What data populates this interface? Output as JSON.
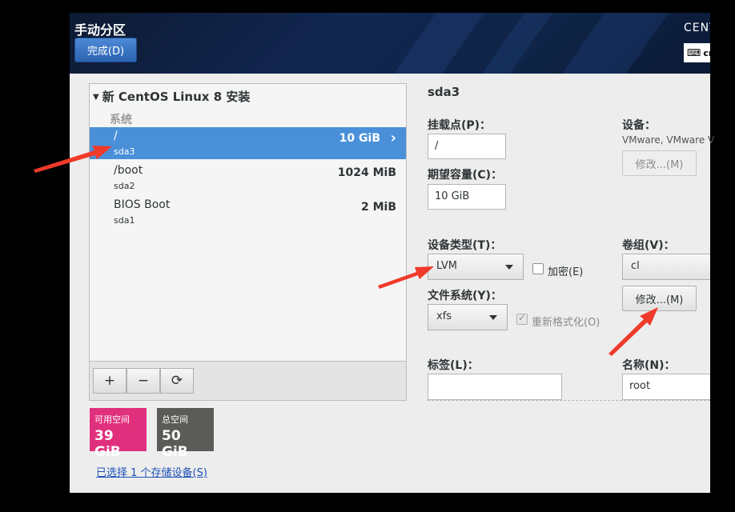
{
  "header": {
    "title": "手动分区",
    "done_label": "完成(D)",
    "product": "CENT",
    "keyboard": "cn"
  },
  "tree": {
    "install_title": "新 CentOS Linux 8 安装",
    "group_label": "系统",
    "partitions": [
      {
        "mount": "/",
        "device": "sda3",
        "size": "10 GiB",
        "selected": true
      },
      {
        "mount": "/boot",
        "device": "sda2",
        "size": "1024 MiB",
        "selected": false
      },
      {
        "mount": "BIOS Boot",
        "device": "sda1",
        "size": "2 MiB",
        "selected": false
      }
    ],
    "tools": {
      "add": "+",
      "remove": "−",
      "refresh": "⟳"
    }
  },
  "space": {
    "available_label": "可用空间",
    "available_value": "39 GiB",
    "total_label": "总空间",
    "total_value": "50 GiB"
  },
  "storage_link": "已选择 1 个存储设备(S)",
  "detail": {
    "title": "sda3",
    "mount_label": "挂载点(P)：",
    "mount_value": "/",
    "capacity_label": "期望容量(C)：",
    "capacity_value": "10 GiB",
    "device_label": "设备：",
    "device_value": "VMware, VMware V",
    "device_modify": "修改...(M)",
    "device_type_label": "设备类型(T)：",
    "device_type_value": "LVM",
    "encrypt_label": "加密(E)",
    "volume_group_label": "卷组(V)：",
    "volume_group_value": "cl",
    "vg_modify": "修改...(M)",
    "fs_label": "文件系统(Y)：",
    "fs_value": "xfs",
    "reformat_label": "重新格式化(O)",
    "tag_label": "标签(L)：",
    "tag_value": "",
    "name_label": "名称(N)：",
    "name_value": "root"
  },
  "colors": {
    "selected_row": "#4a90d9",
    "available_space": "#e0307d",
    "total_space": "#5b5b58",
    "annotation_arrow": "#f03a2a"
  }
}
